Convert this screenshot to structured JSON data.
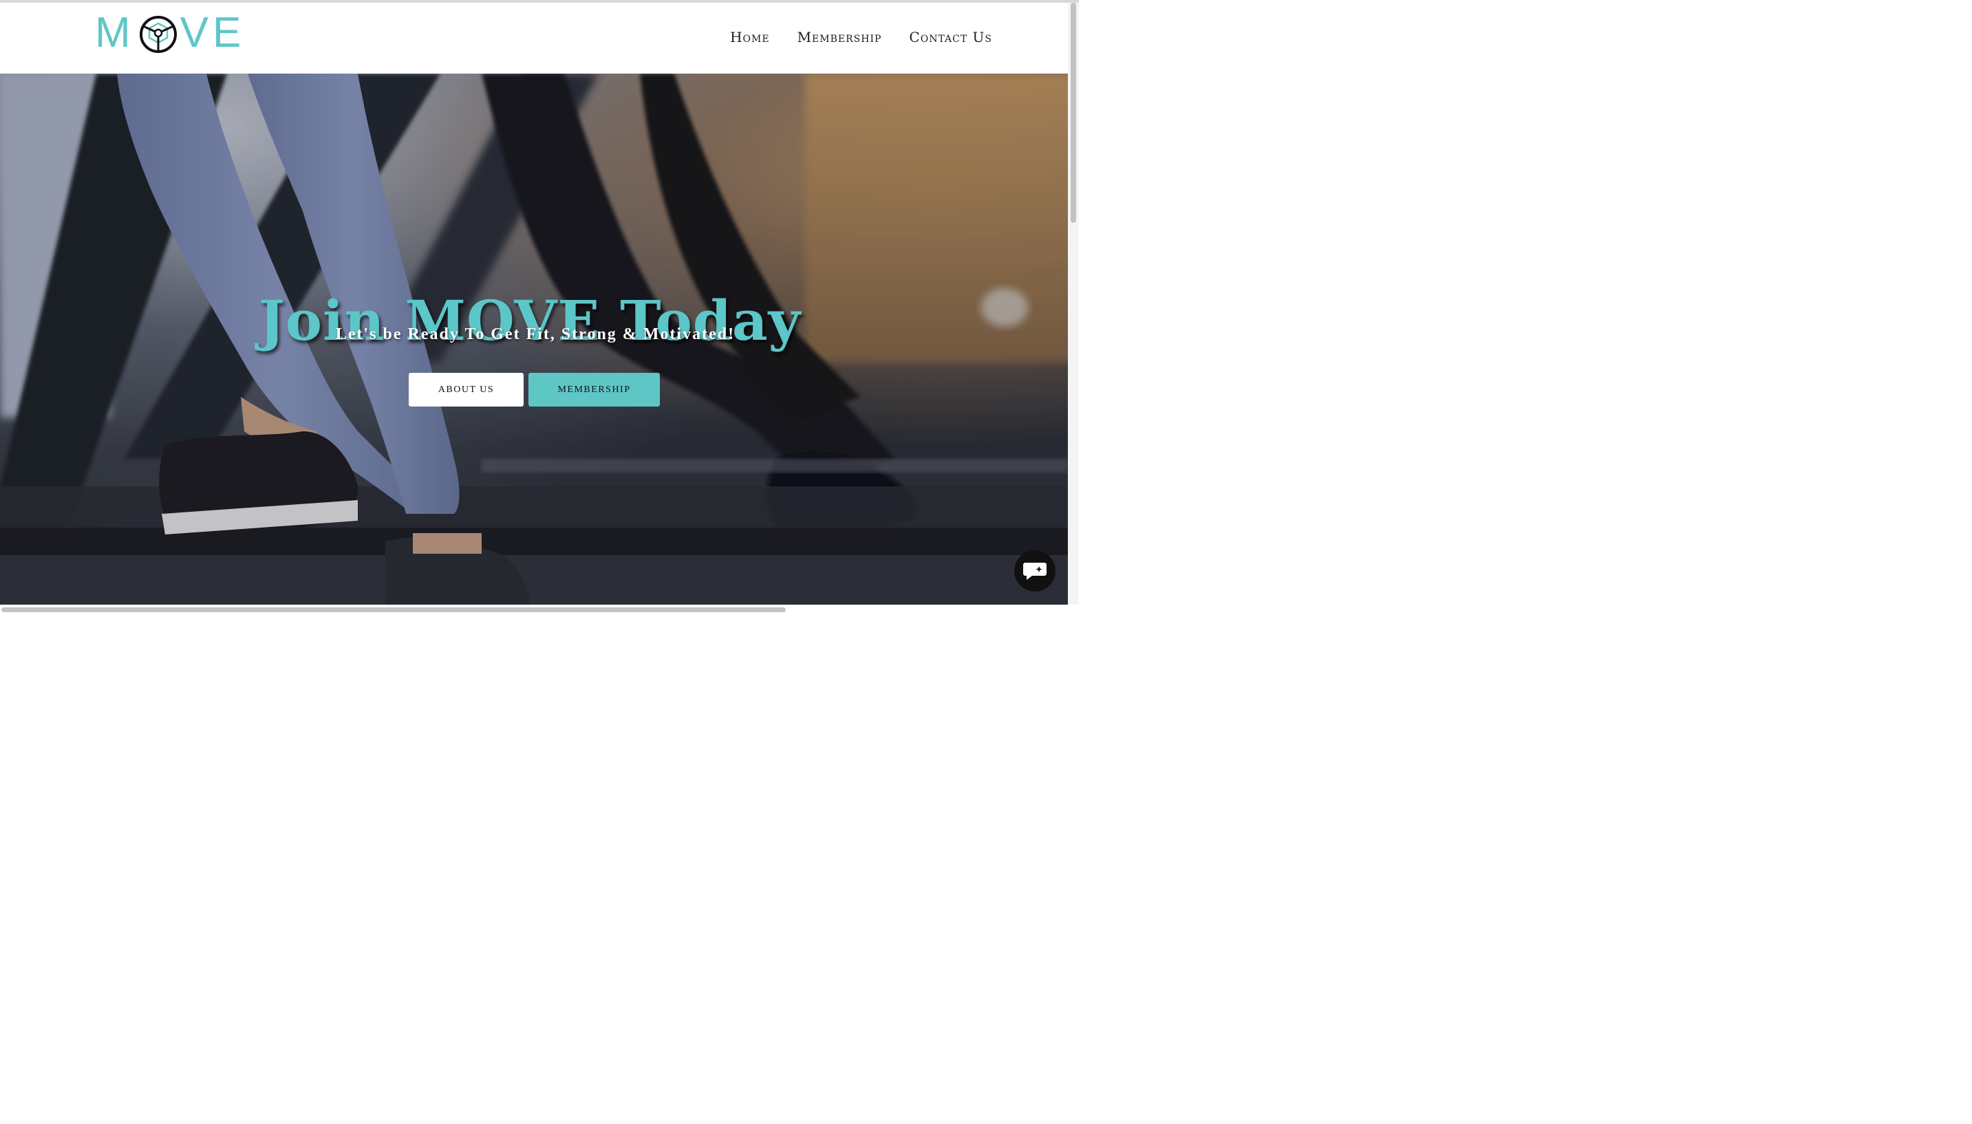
{
  "logo": {
    "letters_left": "M",
    "letters_right": "VE",
    "brand_color": "#5fc6c8",
    "mark_icon": "compass-circle-icon"
  },
  "nav": {
    "items": [
      {
        "label": "Home"
      },
      {
        "label": "Membership"
      },
      {
        "label": "Contact Us"
      }
    ]
  },
  "hero": {
    "title": "Join MOVE Today",
    "subtitle": "Let's be Ready To Get Fit, Strong & Motivated!",
    "buttons": [
      {
        "label": "ABOUT US"
      },
      {
        "label": "MEMBERSHIP"
      }
    ],
    "background_image": "treadmill-runners-photo"
  },
  "chat": {
    "icon": "chat-bubble-icon"
  },
  "colors": {
    "accent": "#5fc6c8",
    "text_dark": "#1d1d1d"
  }
}
